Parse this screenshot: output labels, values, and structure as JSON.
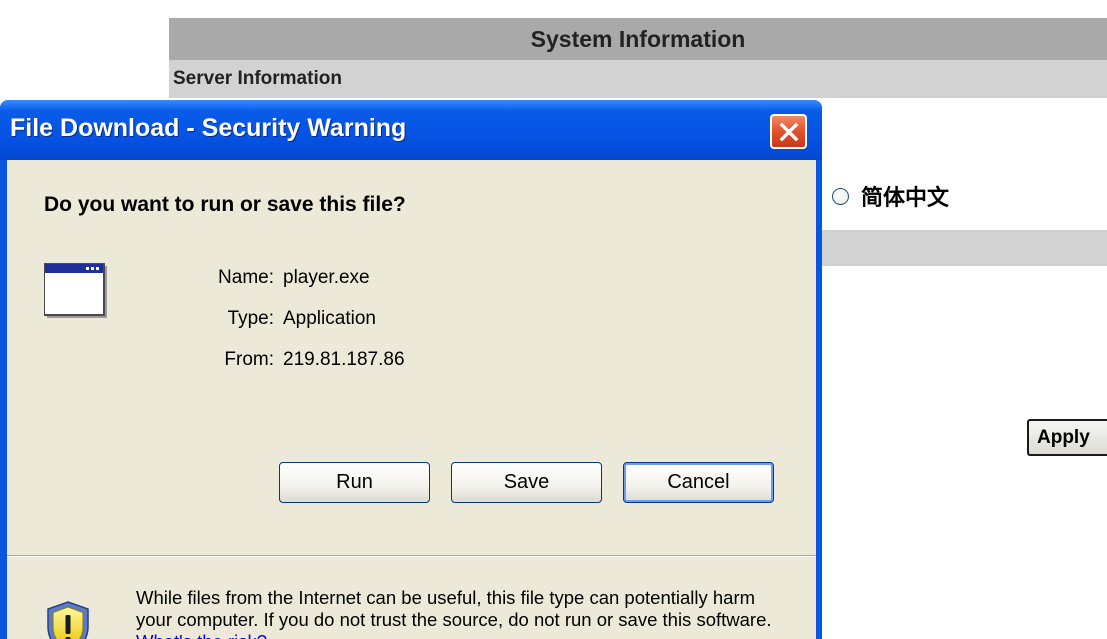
{
  "page": {
    "header_title": "System Information",
    "section_title": "Server Information",
    "language_option_label": "简体中文",
    "apply_label": "Apply"
  },
  "dialog": {
    "title": "File Download - Security Warning",
    "question": "Do you want to run or save this file?",
    "file_info": {
      "name_label": "Name:",
      "name_value": "player.exe",
      "type_label": "Type:",
      "type_value": "Application",
      "from_label": "From:",
      "from_value": "219.81.187.86"
    },
    "buttons": {
      "run": "Run",
      "save": "Save",
      "cancel": "Cancel"
    },
    "warning_text": "While files from the Internet can be useful, this file type can potentially harm your computer. If you do not trust the source, do not run or save this software.",
    "risk_link": "What's the risk?"
  },
  "colors": {
    "titlebar": "#0653e4",
    "dialog_face": "#ece9d8",
    "close_button": "#e3502a",
    "link": "#0000ff",
    "page_header": "#a9a9a9",
    "page_bar": "#d2d2d2"
  },
  "icons": [
    "close-icon",
    "application-window-icon",
    "security-shield-icon",
    "radio-button"
  ]
}
